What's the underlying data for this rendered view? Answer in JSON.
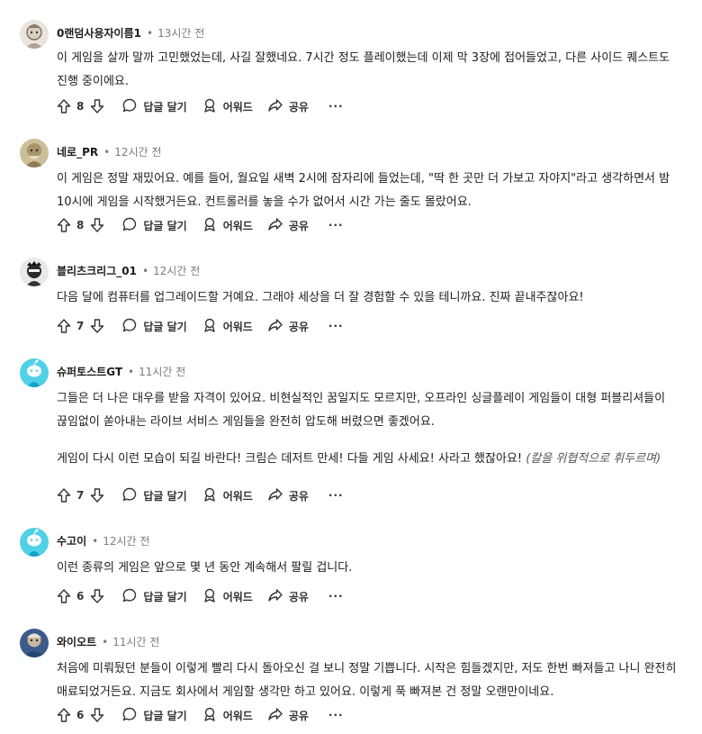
{
  "labels": {
    "reply": "답글 달기",
    "award": "어워드",
    "share": "공유",
    "more": "···"
  },
  "comments": [
    {
      "author": "0랜덤사용자이름1",
      "time": "13시간 전",
      "votes": "8",
      "paragraphs": [
        "이 게임을 살까 말까 고민했었는데, 사길 잘했네요. 7시간 정도 플레이했는데 이제 막 3장에 접어들었고, 다른 사이드 퀘스트도 진행 중이에요."
      ]
    },
    {
      "author": "네로_PR",
      "time": "12시간 전",
      "votes": "8",
      "paragraphs": [
        "이 게임은 정말 재밌어요. 예를 들어, 월요일 새벽 2시에 잠자리에 들었는데, \"딱 한 곳만 더 가보고 자야지\"라고 생각하면서 밤 10시에 게임을 시작했거든요. 컨트롤러를 놓을 수가 없어서 시간 가는 줄도 몰랐어요."
      ]
    },
    {
      "author": "블리츠크리그_01",
      "time": "12시간 전",
      "votes": "7",
      "paragraphs": [
        "다음 달에 컴퓨터를 업그레이드할 거예요. 그래야 세상을 더 잘 경험할 수 있을 테니까요. 진짜 끝내주잖아요!"
      ]
    },
    {
      "author": "슈퍼토스트GT",
      "time": "11시간 전",
      "votes": "7",
      "paragraphs": [
        "그들은 더 나은 대우를 받을 자격이 있어요. 비현실적인 꿈일지도 모르지만, 오프라인 싱글플레이 게임들이 대형 퍼블리셔들이 끊임없이 쏟아내는 라이브 서비스 게임들을 완전히 압도해 버렸으면 좋겠어요.",
        "게임이 다시 이런 모습이 되길 바란다! 크림슨 데저트 만세! 다들 게임 사세요! 사라고 했잖아요!"
      ],
      "aside": "(칼을 위협적으로 휘두르며)"
    },
    {
      "author": "수고이",
      "time": "12시간 전",
      "votes": "6",
      "paragraphs": [
        "이런 종류의 게임은 앞으로 몇 년 동안 계속해서 팔릴 겁니다."
      ]
    },
    {
      "author": "와이오트",
      "time": "11시간 전",
      "votes": "6",
      "paragraphs": [
        "처음에 미뤄뒀던 분들이 이렇게 빨리 다시 돌아오신 걸 보니 정말 기쁩니다. 시작은 힘들겠지만, 저도 한번 빠져들고 나니 완전히 매료되었거든요. 지금도 회사에서 게임할 생각만 하고 있어요. 이렇게 푹 빠져본 건 정말 오랜만이네요."
      ]
    }
  ]
}
